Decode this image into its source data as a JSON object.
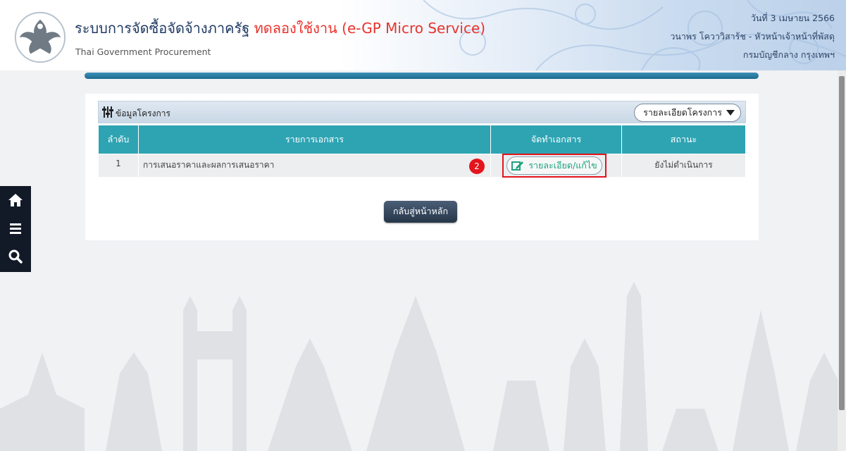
{
  "header": {
    "title_main": "ระบบการจัดซื้อจัดจ้างภาครัฐ",
    "title_trial": "ทดลองใช้งาน (e-GP Micro Service)",
    "subtitle": "Thai Government Procurement",
    "date": "วันที่ 3 เมษายน 2566",
    "user": "วนาพร โควาวิสาร้ช - หัวหน้าเจ้าหน้าที่พัสดุ",
    "org": "กรมบัญชีกลาง กรุงเทพฯ"
  },
  "nav": {
    "icons": [
      "home-icon",
      "menu-icon",
      "search-icon"
    ]
  },
  "panel": {
    "title": "ข้อมูลโครงการ",
    "dropdown_label": "รายละเอียดโครงการ",
    "table": {
      "headers": [
        "ลำดับ",
        "รายการเอกสาร",
        "จัดทำเอกสาร",
        "สถานะ"
      ],
      "rows": [
        {
          "index": "1",
          "document": "การเสนอราคาและผลการเสนอราคา",
          "action_label": "รายละเอียด/แก้ไข",
          "status": "ยังไม่ดำเนินการ"
        }
      ]
    },
    "step_badge": "2",
    "back_label": "กลับสู่หน้าหลัก"
  },
  "colors": {
    "table_header": "#2ea4b3",
    "highlight": "#e4141d",
    "trial_text": "#e8332d",
    "action_text": "#1fa27f"
  }
}
